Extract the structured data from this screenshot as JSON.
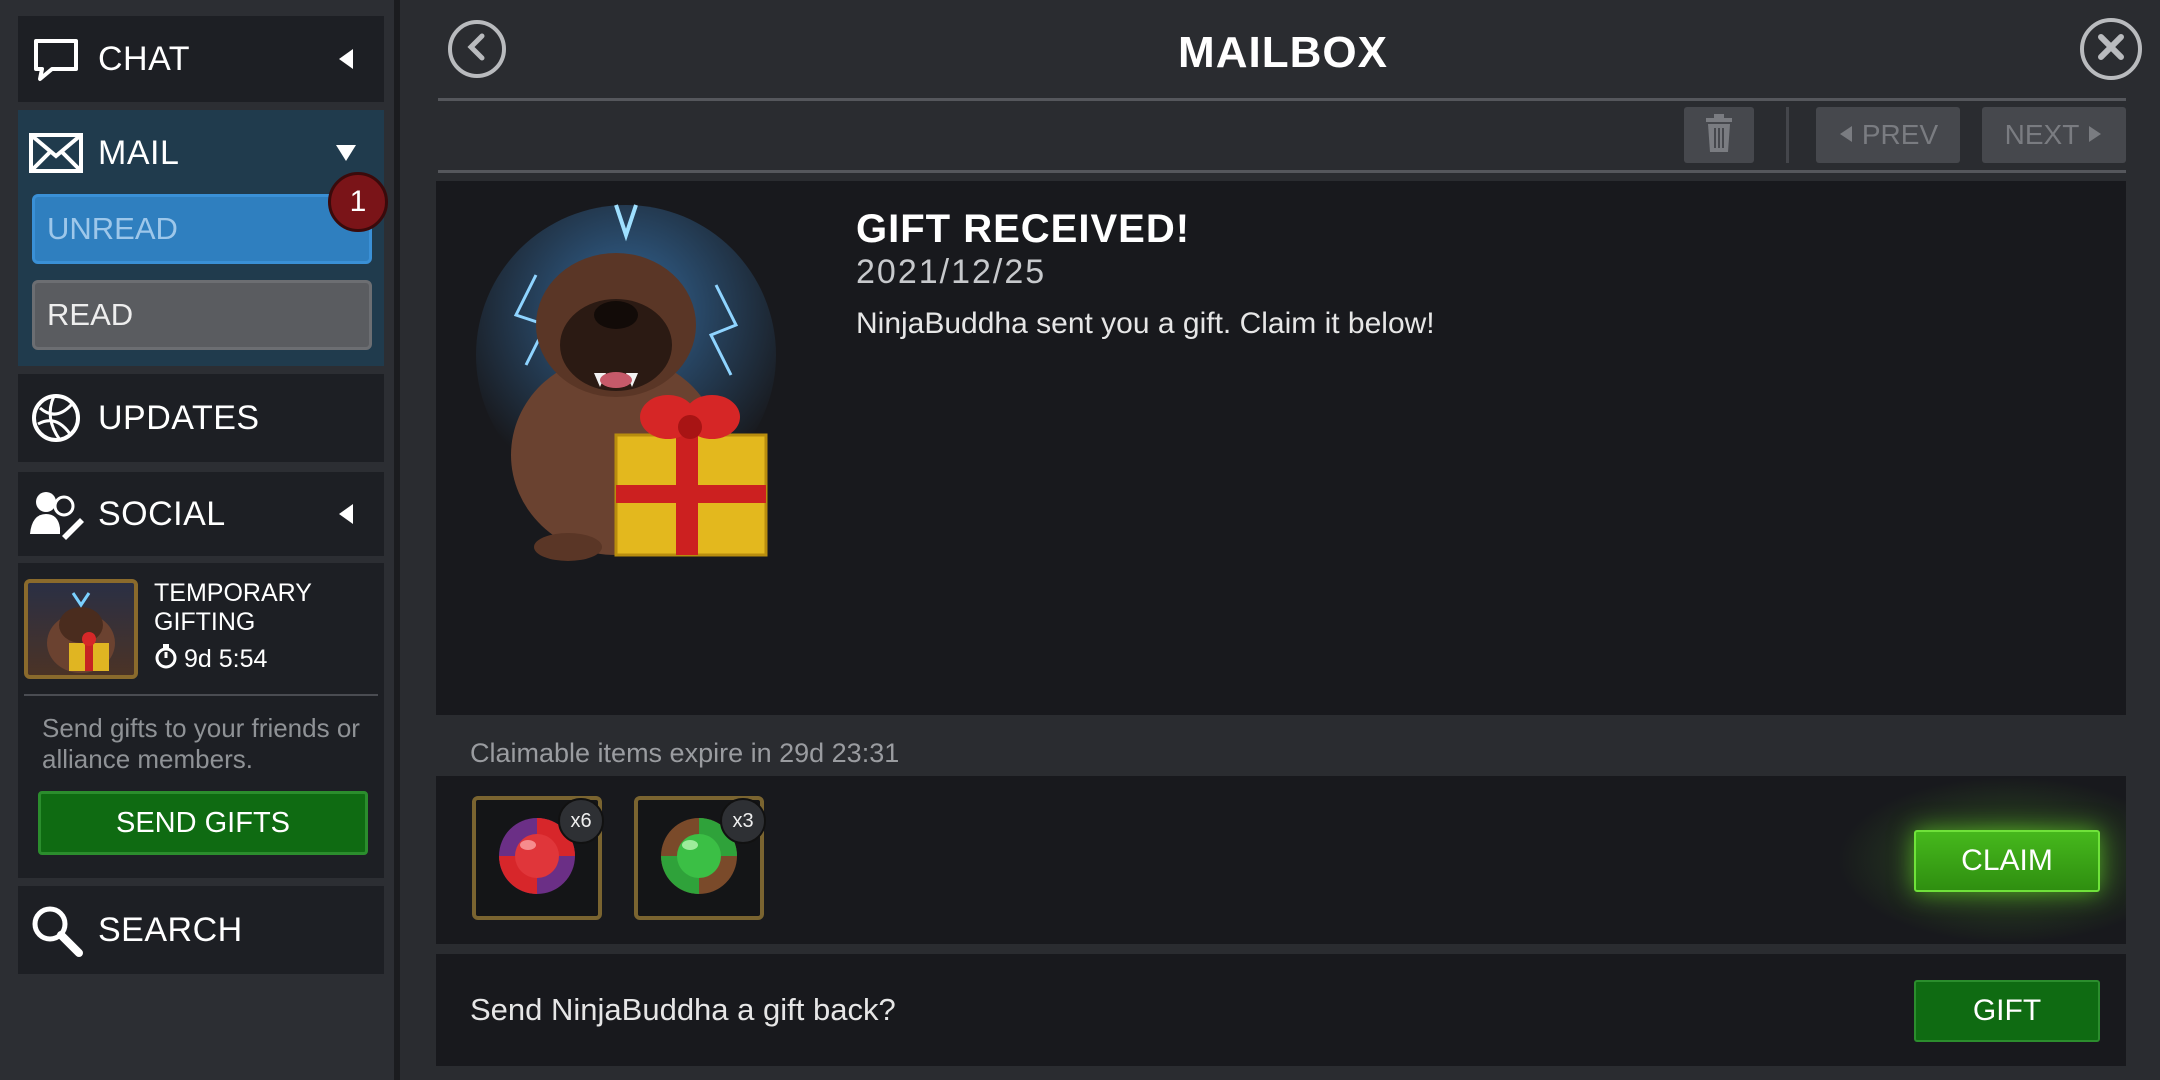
{
  "sidebar": {
    "chat": {
      "label": "CHAT",
      "icon": "chat-bubble-icon"
    },
    "mail": {
      "label": "MAIL",
      "icon": "envelope-icon",
      "unread_label": "UNREAD",
      "unread_count": "1",
      "read_label": "READ"
    },
    "updates": {
      "label": "UPDATES",
      "icon": "globe-icon"
    },
    "social": {
      "label": "SOCIAL",
      "icon": "people-icon"
    },
    "gifting": {
      "title": "TEMPORARY GIFTING",
      "timer": "9d 5:54",
      "description": "Send gifts to your friends or alliance members.",
      "send_button": "SEND GIFTS"
    },
    "search": {
      "label": "SEARCH",
      "icon": "magnifier-icon"
    }
  },
  "header": {
    "title": "MAILBOX",
    "prev_label": "PREV",
    "next_label": "NEXT"
  },
  "message": {
    "title": "GIFT RECEIVED!",
    "date": "2021/12/25",
    "body": "NinjaBuddha sent you a gift. Claim it below!",
    "expire_text": "Claimable items expire in 29d 23:31"
  },
  "rewards": [
    {
      "name": "red-purple-crystal",
      "count": "x6"
    },
    {
      "name": "green-crystal",
      "count": "x3"
    }
  ],
  "actions": {
    "claim_label": "CLAIM",
    "giftback_text": "Send NinjaBuddha a gift back?",
    "gift_label": "GIFT"
  },
  "colors": {
    "accent_blue": "#2f7fbf",
    "claim_green": "#46b81c",
    "badge_red": "#7a1418"
  }
}
